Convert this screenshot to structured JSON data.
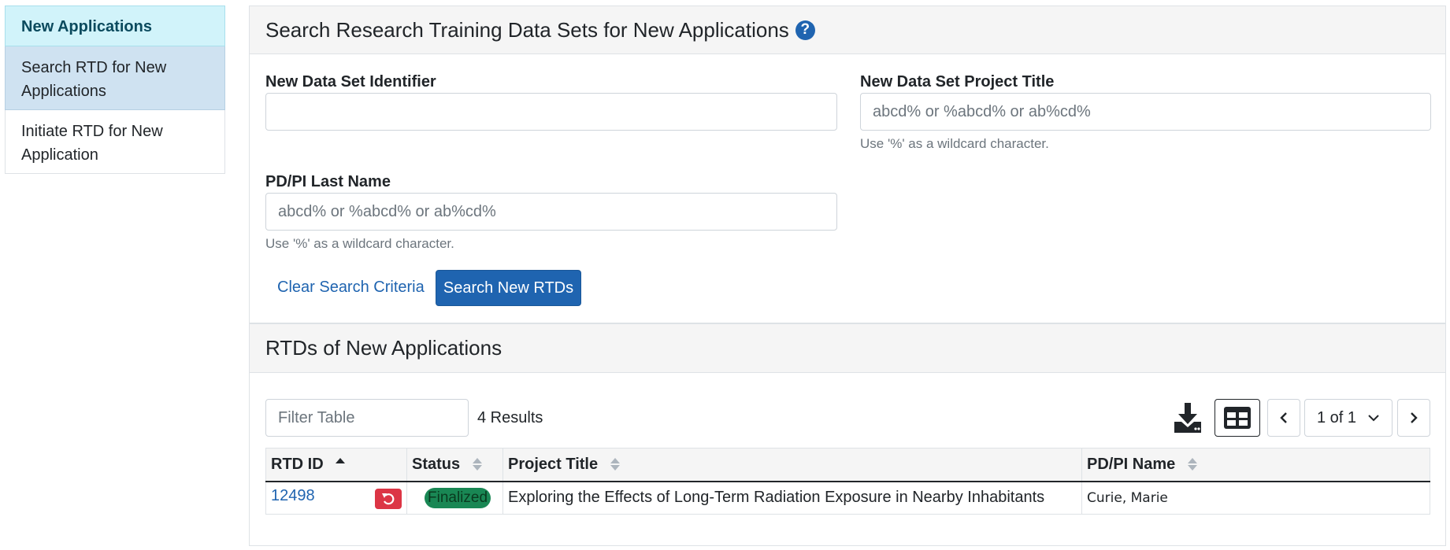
{
  "sidebar": {
    "heading": "New Applications",
    "items": [
      {
        "label": "Search RTD for New Applications"
      },
      {
        "label": "Initiate RTD for New Application"
      }
    ]
  },
  "search_panel": {
    "title": "Search Research Training Data Sets for New Applications",
    "help_icon": "question-circle-icon",
    "fields": {
      "identifier": {
        "label": "New Data Set Identifier",
        "value": "",
        "placeholder": ""
      },
      "project_title": {
        "label": "New Data Set Project Title",
        "value": "",
        "placeholder": "abcd% or %abcd% or ab%cd%",
        "help": "Use '%' as a wildcard character."
      },
      "pi_last_name": {
        "label": "PD/PI Last Name",
        "value": "",
        "placeholder": "abcd% or %abcd% or ab%cd%",
        "help": "Use '%' as a wildcard character."
      }
    },
    "clear_label": "Clear Search Criteria",
    "search_label": "Search New RTDs"
  },
  "results_panel": {
    "title": "RTDs of New Applications",
    "filter_placeholder": "Filter Table",
    "result_count": "4 Results",
    "pagination": {
      "current": "1 of 1"
    },
    "columns": [
      "RTD ID",
      "Status",
      "Project Title",
      "PD/PI Name"
    ],
    "sort": {
      "column": "RTD ID",
      "direction": "ascending"
    },
    "rows": [
      {
        "rtd_id": "12498",
        "status": "Finalized",
        "project_title": "Exploring the Effects of Long-Term Radiation Exposure in Nearby Inhabitants",
        "pi_name": "Curie, Marie"
      }
    ]
  },
  "colors": {
    "primary": "#1f64b0",
    "sidebar_heading_bg": "#d1f3fa",
    "sidebar_active_bg": "#cfe2f1",
    "danger": "#dc3545",
    "status_badge": "#198754"
  },
  "icons": [
    "question-circle-icon",
    "download-icon",
    "table-grid-icon",
    "chevron-left-icon",
    "chevron-right-icon",
    "chevron-down-icon",
    "undo-icon",
    "sort-icon"
  ]
}
